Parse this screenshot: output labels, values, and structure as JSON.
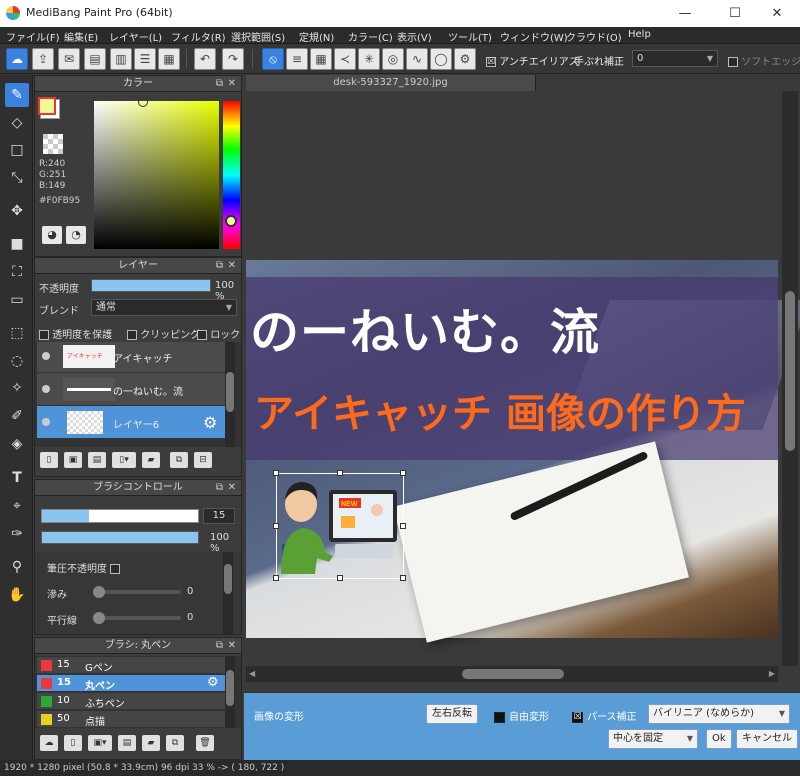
{
  "window": {
    "title": "MediBang Paint Pro (64bit)",
    "minimize": "—",
    "maximize": "☐",
    "close": "✕"
  },
  "menu": [
    "ファイル(F)",
    "編集(E)",
    "レイヤー(L)",
    "フィルタ(R)",
    "選択範囲(S)",
    "定規(N)",
    "カラー(C)",
    "表示(V)",
    "ツール(T)",
    "ウィンドウ(W)",
    "クラウド(O)",
    "Help"
  ],
  "toolbar": {
    "antialias_label": "アンチエイリアス",
    "antialias_checked": "☒",
    "stabilizer_label": "手ぶれ補正",
    "stabilizer_value": "0",
    "softedge_label": "ソフトエッジ"
  },
  "color_panel": {
    "title": "カラー",
    "r": "R:240",
    "g": "G:251",
    "b": "B:149",
    "hex": "#F0FB95",
    "fg_color": "#F0FB95"
  },
  "layer_panel": {
    "title": "レイヤー",
    "opacity_label": "不透明度",
    "opacity_value": "100 %",
    "opacity_fraction": 1.0,
    "blend_label": "ブレンド",
    "blend_value": "通常",
    "protect_alpha": "透明度を保護",
    "clipping": "クリッピング",
    "lock": "ロック",
    "layers": [
      {
        "name": "アイキャッチ"
      },
      {
        "name": "の一ねいむ。流"
      },
      {
        "name": "レイヤー6",
        "selected": true
      }
    ]
  },
  "brush_control": {
    "title": "ブラシコントロール",
    "size_value": "15",
    "size_fraction": 0.3,
    "opacity_value": "100 %",
    "opacity_fraction": 1.0,
    "pressure_opacity": "筆圧不透明度",
    "blur_label": "滲み",
    "blur_value": "0",
    "parallel_label": "平行線",
    "parallel_value": "0"
  },
  "brush_list": {
    "title": "ブラシ: 丸ペン",
    "items": [
      {
        "size": "15",
        "name": "Gペン",
        "color": "#e83a3a"
      },
      {
        "size": "15",
        "name": "丸ペン",
        "color": "#e83a3a",
        "selected": true
      },
      {
        "size": "10",
        "name": "ふちペン",
        "color": "#2aa838"
      },
      {
        "size": "50",
        "name": "点描",
        "color": "#e8d020"
      }
    ]
  },
  "document": {
    "tab": "desk-593327_1920.jpg",
    "title_line1": "のーねいむ。流",
    "title_line2": "アイキャッチ 画像の作り方",
    "sign_text": "NEW"
  },
  "transform_bar": {
    "label": "画像の変形",
    "flip_button": "左右反転",
    "free_transform": "自由変形",
    "perspective": "パース補正",
    "perspective_checked": "☒",
    "interp_value": "バイリニア (なめらか)",
    "anchor_value": "中心を固定",
    "ok": "Ok",
    "cancel": "キャンセル"
  },
  "status_bar": {
    "text": "1920 * 1280 pixel   (50.8 * 33.9cm)   96 dpi   33 %   -> ( 180, 722 )"
  },
  "icons": {
    "fg": "#F0FB95"
  }
}
